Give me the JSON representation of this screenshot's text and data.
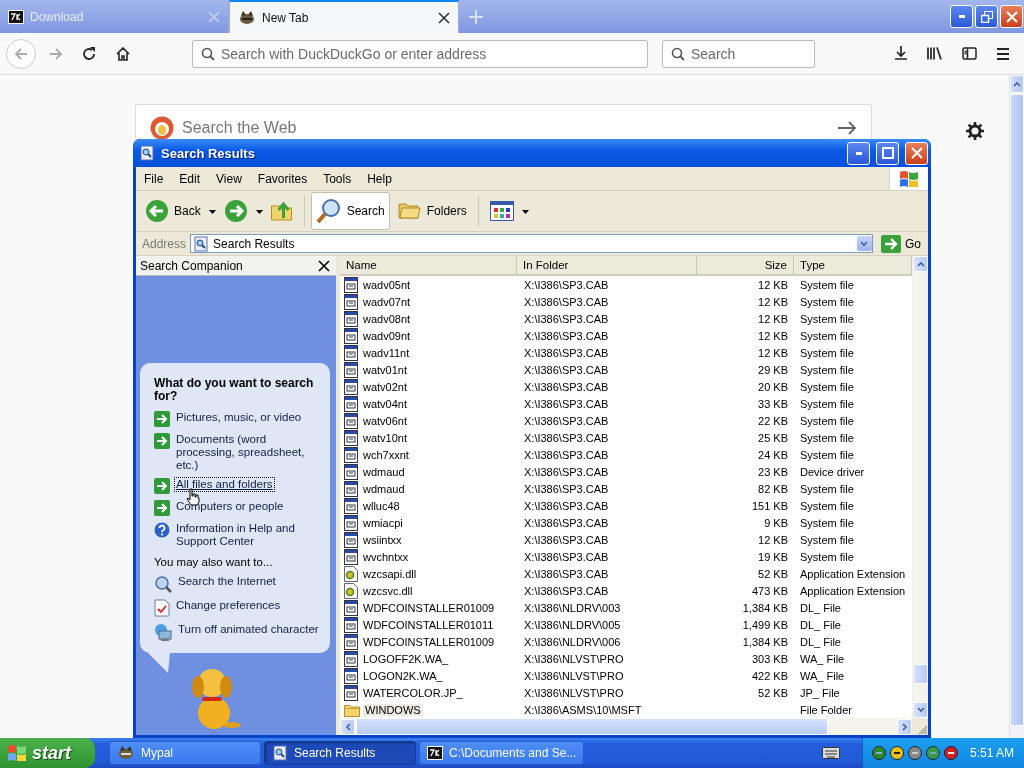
{
  "browser": {
    "tabs": [
      {
        "kind": "archive",
        "label": "Download",
        "selected": false
      },
      {
        "kind": "web",
        "label": "New Tab",
        "selected": true
      }
    ],
    "address_field": {
      "placeholder": "Search with DuckDuckGo or enter address"
    },
    "search_field": {
      "placeholder": "Search"
    },
    "page_search": {
      "placeholder": "Search the Web"
    }
  },
  "explorer": {
    "title": "Search Results",
    "menu": [
      "File",
      "Edit",
      "View",
      "Favorites",
      "Tools",
      "Help"
    ],
    "back_button": {
      "label": "Back"
    },
    "search_button": {
      "label": "Search",
      "pressed": true
    },
    "folders_button": {
      "label": "Folders",
      "pressed": false
    },
    "address": {
      "label": "Address",
      "value": "Search Results",
      "go": "Go"
    },
    "companion": {
      "title": "Search Companion",
      "question": "What do you want to search for?",
      "options": [
        {
          "kind": "arrow",
          "label": "Pictures, music, or video",
          "focused": false
        },
        {
          "kind": "arrow",
          "label": "Documents (word processing, spreadsheet, etc.)",
          "focused": false
        },
        {
          "kind": "arrow",
          "label": "All files and folders",
          "focused": true
        },
        {
          "kind": "arrow",
          "label": "Computers or people",
          "focused": false
        },
        {
          "kind": "help",
          "label": "Information in Help and Support Center",
          "focused": false
        }
      ],
      "also": "You may also want to...",
      "links": [
        {
          "kind": "internet",
          "label": "Search the Internet"
        },
        {
          "kind": "preferences",
          "label": "Change preferences"
        },
        {
          "kind": "character",
          "label": "Turn off animated character"
        }
      ]
    },
    "columns": [
      "Name",
      "In Folder",
      "Size",
      "Type"
    ],
    "rows": [
      {
        "kind": "file",
        "name": "wadv05nt",
        "folder": "X:\\I386\\SP3.CAB",
        "size": "12 KB",
        "type": "System file",
        "selected": false
      },
      {
        "kind": "file",
        "name": "wadv07nt",
        "folder": "X:\\I386\\SP3.CAB",
        "size": "12 KB",
        "type": "System file",
        "selected": false
      },
      {
        "kind": "file",
        "name": "wadv08nt",
        "folder": "X:\\I386\\SP3.CAB",
        "size": "12 KB",
        "type": "System file",
        "selected": false
      },
      {
        "kind": "file",
        "name": "wadv09nt",
        "folder": "X:\\I386\\SP3.CAB",
        "size": "12 KB",
        "type": "System file",
        "selected": false
      },
      {
        "kind": "file",
        "name": "wadv11nt",
        "folder": "X:\\I386\\SP3.CAB",
        "size": "12 KB",
        "type": "System file",
        "selected": false
      },
      {
        "kind": "file",
        "name": "watv01nt",
        "folder": "X:\\I386\\SP3.CAB",
        "size": "29 KB",
        "type": "System file",
        "selected": false
      },
      {
        "kind": "file",
        "name": "watv02nt",
        "folder": "X:\\I386\\SP3.CAB",
        "size": "20 KB",
        "type": "System file",
        "selected": false
      },
      {
        "kind": "file",
        "name": "watv04nt",
        "folder": "X:\\I386\\SP3.CAB",
        "size": "33 KB",
        "type": "System file",
        "selected": false
      },
      {
        "kind": "file",
        "name": "watv06nt",
        "folder": "X:\\I386\\SP3.CAB",
        "size": "22 KB",
        "type": "System file",
        "selected": false
      },
      {
        "kind": "file",
        "name": "watv10nt",
        "folder": "X:\\I386\\SP3.CAB",
        "size": "25 KB",
        "type": "System file",
        "selected": false
      },
      {
        "kind": "file",
        "name": "wch7xxnt",
        "folder": "X:\\I386\\SP3.CAB",
        "size": "24 KB",
        "type": "System file",
        "selected": false
      },
      {
        "kind": "file",
        "name": "wdmaud",
        "folder": "X:\\I386\\SP3.CAB",
        "size": "23 KB",
        "type": "Device driver",
        "selected": false
      },
      {
        "kind": "file",
        "name": "wdmaud",
        "folder": "X:\\I386\\SP3.CAB",
        "size": "82 KB",
        "type": "System file",
        "selected": false
      },
      {
        "kind": "file",
        "name": "wlluc48",
        "folder": "X:\\I386\\SP3.CAB",
        "size": "151 KB",
        "type": "System file",
        "selected": false
      },
      {
        "kind": "file",
        "name": "wmiacpi",
        "folder": "X:\\I386\\SP3.CAB",
        "size": "9 KB",
        "type": "System file",
        "selected": false
      },
      {
        "kind": "file",
        "name": "wsiintxx",
        "folder": "X:\\I386\\SP3.CAB",
        "size": "12 KB",
        "type": "System file",
        "selected": false
      },
      {
        "kind": "file",
        "name": "wvchntxx",
        "folder": "X:\\I386\\SP3.CAB",
        "size": "19 KB",
        "type": "System file",
        "selected": false
      },
      {
        "kind": "dll",
        "name": "wzcsapi.dll",
        "folder": "X:\\I386\\SP3.CAB",
        "size": "52 KB",
        "type": "Application Extension",
        "selected": false
      },
      {
        "kind": "dll",
        "name": "wzcsvc.dll",
        "folder": "X:\\I386\\SP3.CAB",
        "size": "473 KB",
        "type": "Application Extension",
        "selected": false
      },
      {
        "kind": "file",
        "name": "WDFCOINSTALLER01009",
        "folder": "X:\\I386\\NLDRV\\003",
        "size": "1,384 KB",
        "type": "DL_ File",
        "selected": false
      },
      {
        "kind": "file",
        "name": "WDFCOINSTALLER01011",
        "folder": "X:\\I386\\NLDRV\\005",
        "size": "1,499 KB",
        "type": "DL_ File",
        "selected": false
      },
      {
        "kind": "file",
        "name": "WDFCOINSTALLER01009",
        "folder": "X:\\I386\\NLDRV\\006",
        "size": "1,384 KB",
        "type": "DL_ File",
        "selected": false
      },
      {
        "kind": "file",
        "name": "LOGOFF2K.WA_",
        "folder": "X:\\I386\\NLVST\\PRO",
        "size": "303 KB",
        "type": "WA_ File",
        "selected": false
      },
      {
        "kind": "file",
        "name": "LOGON2K.WA_",
        "folder": "X:\\I386\\NLVST\\PRO",
        "size": "422 KB",
        "type": "WA_ File",
        "selected": false
      },
      {
        "kind": "file",
        "name": "WATERCOLOR.JP_",
        "folder": "X:\\I386\\NLVST\\PRO",
        "size": "52 KB",
        "type": "JP_ File",
        "selected": false
      },
      {
        "kind": "folder",
        "name": "WINDOWS",
        "folder": "X:\\I386\\ASMS\\10\\MSFT",
        "type": "File Folder",
        "selected": true
      }
    ]
  },
  "taskbar": {
    "start": "start",
    "tasks": [
      {
        "kind": "bird",
        "label": "Mypal",
        "selected": false
      },
      {
        "kind": "explorer",
        "label": "Search Results",
        "selected": true
      },
      {
        "kind": "archive",
        "label": "C:\\Documents and Se...",
        "selected": false
      }
    ],
    "clock": "5:51 AM"
  }
}
